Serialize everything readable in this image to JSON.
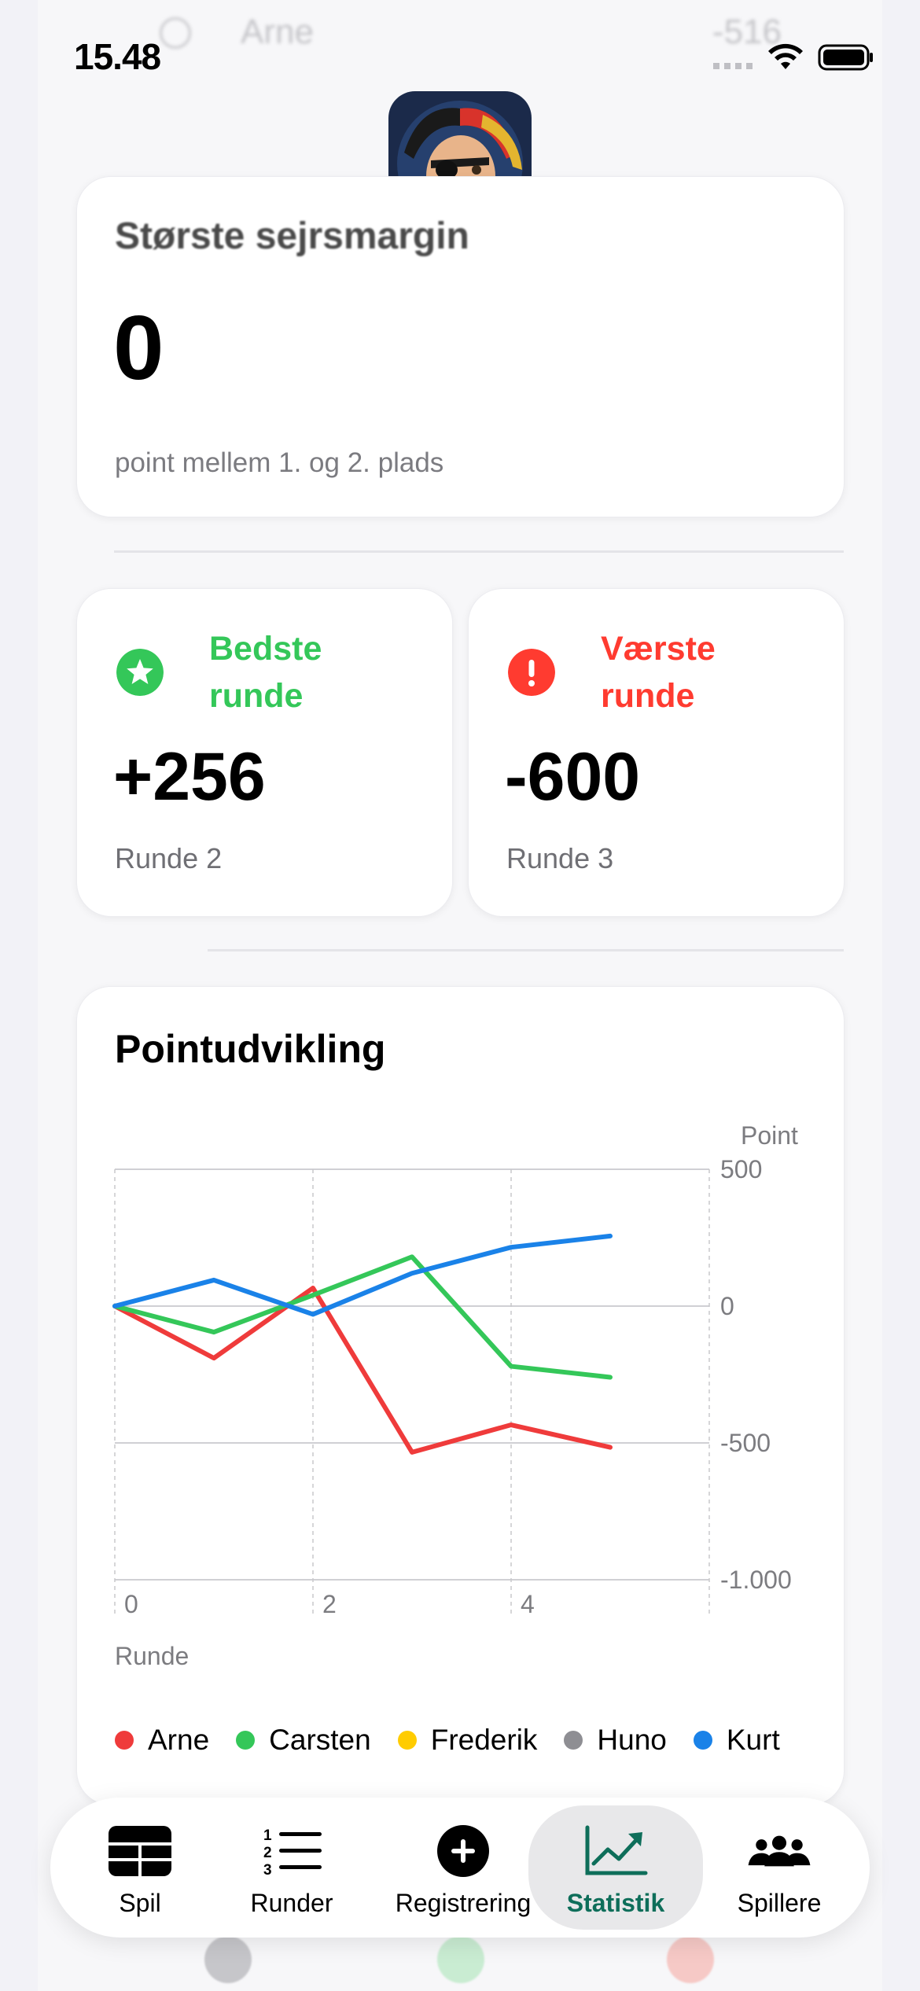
{
  "status_bar": {
    "time": "15.48"
  },
  "underlay_row": {
    "name": "Arne",
    "value": "-516"
  },
  "margin_card": {
    "title": "Største sejrsmargin",
    "value": "0",
    "subtitle": "point mellem 1. og 2. plads"
  },
  "best_round": {
    "title_line1": "Bedste",
    "title_line2": "runde",
    "value": "+256",
    "subtitle": "Runde 2",
    "color": "#34c759",
    "icon": "star-icon"
  },
  "worst_round": {
    "title_line1": "Værste",
    "title_line2": "runde",
    "value": "-600",
    "subtitle": "Runde 3",
    "color": "#ff3b30",
    "icon": "exclamation-icon"
  },
  "chart_title": "Pointudvikling",
  "chart_data": {
    "type": "line",
    "ylabel": "Point",
    "xlabel": "Runde",
    "ylim": [
      -1000,
      500
    ],
    "xlim": [
      0,
      6
    ],
    "y_ticks": [
      "500",
      "0",
      "-500",
      "-1.000"
    ],
    "x_ticks": [
      "0",
      "2",
      "4"
    ],
    "grid": true,
    "legend_position": "bottom",
    "x": [
      0,
      1,
      2,
      3,
      4,
      5
    ],
    "series": [
      {
        "name": "Arne",
        "color": "#ef3b3b",
        "x": [
          0,
          1,
          2,
          3,
          4,
          5
        ],
        "values": [
          0,
          -190,
          66,
          -534,
          -434,
          -516
        ]
      },
      {
        "name": "Carsten",
        "color": "#34c759",
        "x": [
          0,
          1,
          2,
          3,
          4,
          5
        ],
        "values": [
          0,
          -95,
          40,
          180,
          -220,
          -260
        ]
      },
      {
        "name": "Frederik",
        "color": "#ffcc00",
        "x": [],
        "values": []
      },
      {
        "name": "Huno",
        "color": "#8e8e93",
        "x": [],
        "values": []
      },
      {
        "name": "Kurt",
        "color": "#1a82e8",
        "x": [
          0,
          1,
          2,
          3,
          4,
          5
        ],
        "values": [
          0,
          95,
          -30,
          120,
          215,
          256
        ]
      }
    ]
  },
  "tabbar": {
    "tabs": [
      {
        "label": "Spil",
        "icon": "table-icon"
      },
      {
        "label": "Runder",
        "icon": "numbered-list-icon"
      },
      {
        "label": "Registrering",
        "icon": "plus-circle-icon"
      },
      {
        "label": "Statistik",
        "icon": "chart-icon",
        "active": true
      },
      {
        "label": "Spillere",
        "icon": "people-icon"
      }
    ]
  }
}
